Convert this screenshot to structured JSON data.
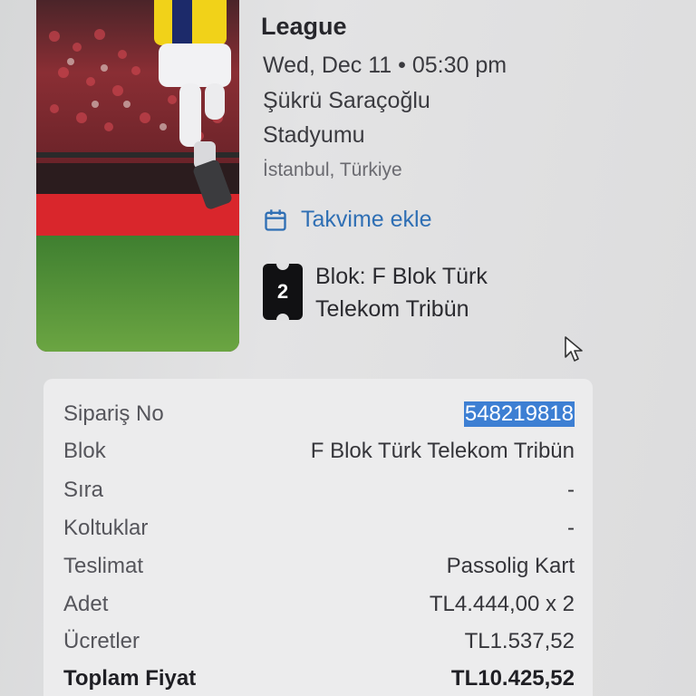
{
  "event": {
    "title": "League",
    "datetime": "Wed, Dec 11 • 05:30 pm",
    "venue_line1": "Şükrü Saraçoğlu",
    "venue_line2": "Stadyumu",
    "city": "İstanbul, Türkiye",
    "add_to_calendar": "Takvime ekle",
    "ticket_count": "2",
    "block_line1": "Blok: F Blok Türk",
    "block_line2": "Telekom Tribün"
  },
  "summary": {
    "rows": [
      {
        "label": "Sipariş No",
        "value": "548219818"
      },
      {
        "label": "Blok",
        "value": "F Blok Türk Telekom Tribün"
      },
      {
        "label": "Sıra",
        "value": "-"
      },
      {
        "label": "Koltuklar",
        "value": "-"
      },
      {
        "label": "Teslimat",
        "value": "Passolig Kart"
      },
      {
        "label": "Adet",
        "value": "TL4.444,00 x 2"
      },
      {
        "label": "Ücretler",
        "value": "TL1.537,52"
      },
      {
        "label": "Toplam Fiyat",
        "value": "TL10.425,52"
      }
    ]
  },
  "colors": {
    "link": "#2f6fb4",
    "selection": "#3d7fd3",
    "badge": "#111113"
  },
  "icons": {
    "calendar": "calendar-icon",
    "ticket": "ticket-icon",
    "cursor": "mouse-pointer-icon"
  }
}
